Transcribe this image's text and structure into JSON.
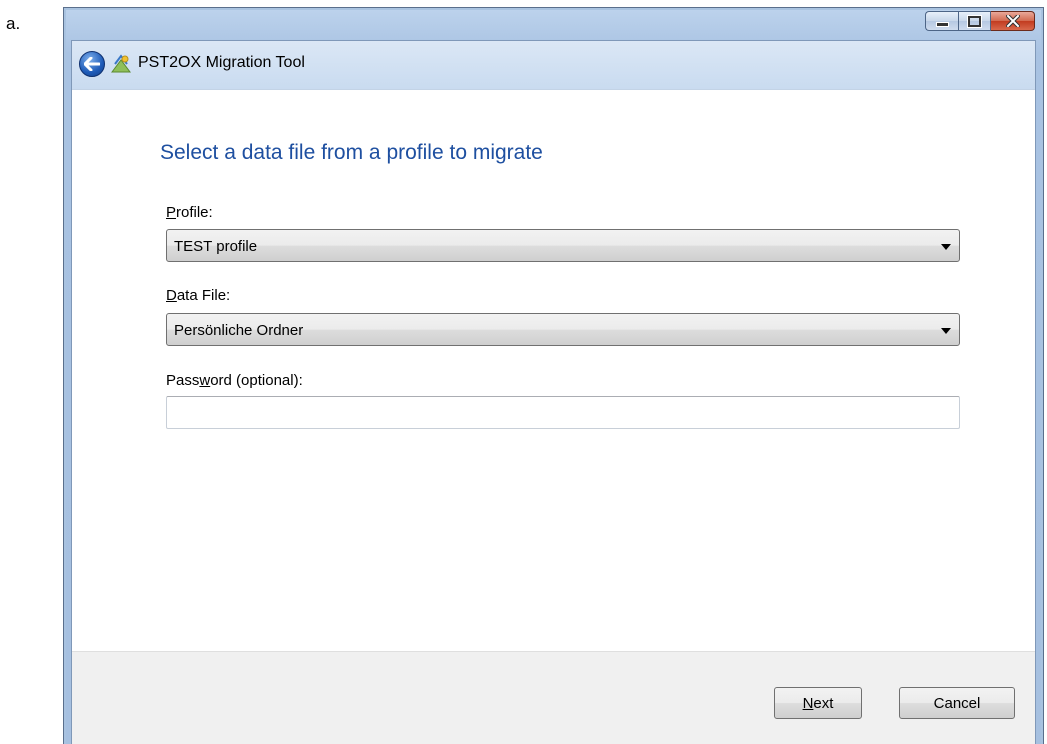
{
  "doc_label": "a.",
  "window": {
    "title": "PST2OX Migration Tool",
    "buttons": {
      "minimize_icon": "minimize-icon",
      "maximize_icon": "maximize-icon",
      "close_icon": "close-icon"
    }
  },
  "page": {
    "heading": "Select a data file from a profile to migrate",
    "profile": {
      "label_underlined": "P",
      "label_rest": "rofile:",
      "value": "TEST profile"
    },
    "data_file": {
      "label_underlined": "D",
      "label_rest": "ata File:",
      "value": "Persönliche Ordner"
    },
    "password": {
      "label_pre": "Pass",
      "label_underlined": "w",
      "label_rest": "ord (optional):",
      "value": ""
    }
  },
  "footer": {
    "next": {
      "underlined": "N",
      "rest": "ext"
    },
    "cancel": "Cancel"
  },
  "colors": {
    "heading": "#1e4fa0",
    "frame": "#a9c3e0",
    "close": "#c23b1f"
  }
}
